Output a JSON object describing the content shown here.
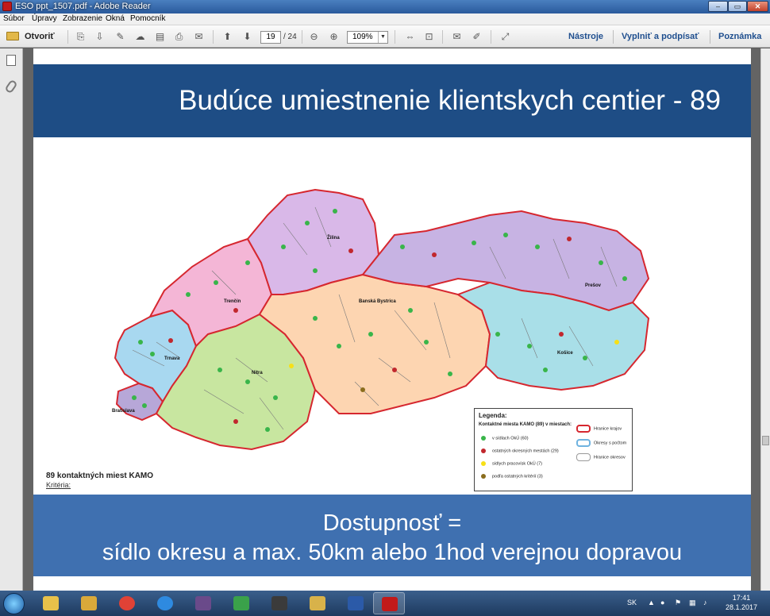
{
  "window": {
    "title": "ESO ppt_1507.pdf - Adobe Reader",
    "min_label": "–",
    "max_label": "▭",
    "close_label": "✕"
  },
  "menu": {
    "items": [
      "Súbor",
      "Úpravy",
      "Zobrazenie",
      "Okná",
      "Pomocník"
    ]
  },
  "toolbar": {
    "open_label": "Otvoriť",
    "page_current": "19",
    "page_total": "/ 24",
    "zoom": "109%",
    "tools_label": "Nástroje",
    "fill_sign_label": "Vyplniť a podpísať",
    "comment_label": "Poznámka"
  },
  "slide": {
    "header": "Budúce umiestnenie klientskych centier  - 89",
    "footer_line1": "Dostupnosť  =",
    "footer_line2": "sídlo okresu a max. 50km alebo 1hod verejnou dopravou",
    "criteria_title": "89 kontaktných miest KAMO",
    "criteria_sub": "Kritéria:"
  },
  "legend": {
    "title": "Legenda:",
    "subtitle": "Kontaktné miesta KAMO (89) v miestach:",
    "rows": [
      {
        "label": "v sídlach OkÚ (60)",
        "color": "#39b54a"
      },
      {
        "label": "ostatných okresných mestách (29)",
        "color": "#c1272d"
      },
      {
        "label": "sídlych pracovísk OkÚ (7)",
        "color": "#f7e017"
      },
      {
        "label": "podľa ostatných kritérií (3)",
        "color": "#8a6d1d"
      }
    ],
    "boundaries": [
      {
        "label": "Hranice krajov",
        "color": "#d6272f"
      },
      {
        "label": "Okresy s počtom",
        "color": "#6fb3e0"
      },
      {
        "label": "Hranice okresov",
        "color": "#9a9a9a"
      }
    ]
  },
  "map": {
    "regions_color": {
      "bratislava": "#b7a7d8",
      "trnava": "#a8d8f0",
      "trencin": "#f4b6d6",
      "nitra": "#c8e6a0",
      "zilina": "#d9b8e8",
      "banska_bystrica": "#fdd5b1",
      "presov": "#c7b3e3",
      "kosice": "#a9dfe8"
    },
    "town_labels": [
      "Bratislava",
      "Trnava",
      "Trenčín",
      "Nitra",
      "Žilina",
      "Banská Bystrica",
      "Prešov",
      "Košice"
    ]
  },
  "taskbar": {
    "lang": "SK",
    "time": "17:41",
    "date": "28.1.2017"
  }
}
